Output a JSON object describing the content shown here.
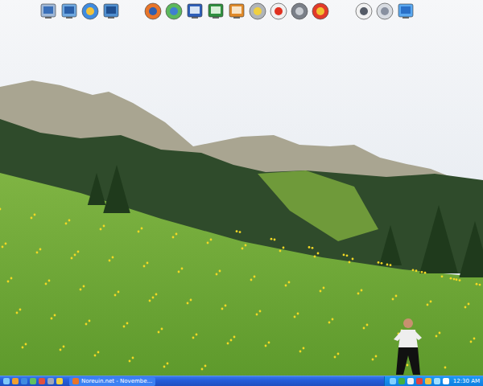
{
  "desktop": {
    "wallpaper": "photo"
  },
  "taskbar": {
    "window_buttons": [
      {
        "title": "Noreuin.net - Novembe...",
        "selected": false
      }
    ],
    "clock": "12:30 AM"
  }
}
